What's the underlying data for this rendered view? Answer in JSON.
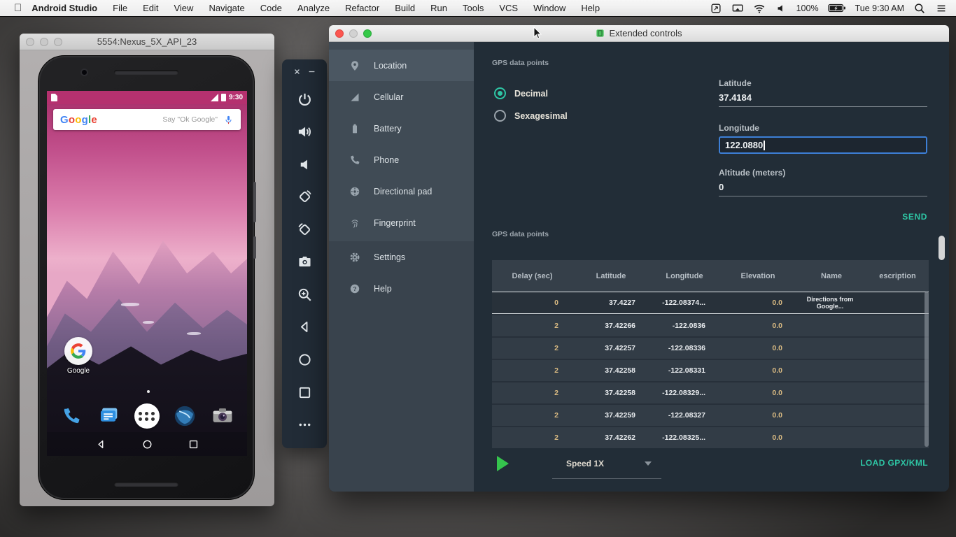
{
  "menu_bar": {
    "apple_logo": "apple-icon",
    "app_name": "Android Studio",
    "menus": [
      "File",
      "Edit",
      "View",
      "Navigate",
      "Code",
      "Analyze",
      "Refactor",
      "Build",
      "Run",
      "Tools",
      "VCS",
      "Window",
      "Help"
    ],
    "status": [
      {
        "icon": "sync-icon"
      },
      {
        "icon": "display-icon"
      },
      {
        "icon": "wifi-icon"
      },
      {
        "icon": "volume-menu-icon"
      },
      {
        "text": "100%"
      },
      {
        "icon": "mac-battery-icon"
      },
      {
        "text": "Tue 9:30 AM"
      },
      {
        "icon": "search-icon"
      },
      {
        "icon": "list-icon"
      }
    ]
  },
  "emulator": {
    "title": "5554:Nexus_5X_API_23",
    "phone": {
      "status_time": "9:30",
      "search": {
        "logo": "Google",
        "placeholder": "Say \"Ok Google\"",
        "mic_icon": "mic-icon"
      },
      "folder_label": "Google",
      "dock": [
        "phone-app-icon",
        "messenger-icon",
        "app-drawer-icon",
        "browser-icon",
        "camera-app-icon"
      ],
      "nav": [
        "back-nav-icon",
        "home-nav-icon",
        "overview-nav-icon"
      ]
    }
  },
  "toolbar": {
    "window_controls": [
      {
        "icon": "close-icon",
        "name": "toolbar-close-button"
      },
      {
        "icon": "minimize-icon",
        "name": "toolbar-minimize-button"
      }
    ],
    "buttons": [
      {
        "icon": "power-icon",
        "name": "power-button"
      },
      {
        "icon": "volume-up-icon",
        "name": "volume-up-button"
      },
      {
        "icon": "volume-down-icon",
        "name": "volume-down-button"
      },
      {
        "icon": "rotate-left-icon",
        "name": "rotate-left-button"
      },
      {
        "icon": "rotate-right-icon",
        "name": "rotate-right-button"
      },
      {
        "icon": "screenshot-icon",
        "name": "screenshot-button"
      },
      {
        "icon": "zoom-icon",
        "name": "zoom-button"
      },
      {
        "icon": "back-nav-icon",
        "name": "back-button"
      },
      {
        "icon": "home-nav-icon",
        "name": "home-button"
      },
      {
        "icon": "overview-nav-icon",
        "name": "overview-button"
      },
      {
        "icon": "more-icon",
        "name": "more-button"
      }
    ]
  },
  "extended": {
    "title": "Extended controls",
    "sidebar": [
      {
        "label": "Location",
        "icon": "location-pin-icon",
        "selected": true
      },
      {
        "label": "Cellular",
        "icon": "cellular-icon",
        "selected": false
      },
      {
        "label": "Battery",
        "icon": "battery-side-icon",
        "selected": false
      },
      {
        "label": "Phone",
        "icon": "phone-handset-icon",
        "selected": false
      },
      {
        "label": "Directional pad",
        "icon": "dpad-icon",
        "selected": false
      },
      {
        "label": "Fingerprint",
        "icon": "fingerprint-icon",
        "selected": false
      },
      {
        "label": "Settings",
        "icon": "gear-icon",
        "selected": false
      },
      {
        "label": "Help",
        "icon": "help-icon",
        "selected": false
      }
    ],
    "gps_form": {
      "section": "GPS data points",
      "radios": [
        {
          "label": "Decimal",
          "selected": true
        },
        {
          "label": "Sexagesimal",
          "selected": false
        }
      ],
      "fields": [
        {
          "label": "Latitude",
          "value": "37.4184",
          "focused": false
        },
        {
          "label": "Longitude",
          "value": "122.0880",
          "focused": true
        },
        {
          "label": "Altitude (meters)",
          "value": "0",
          "focused": false
        }
      ],
      "send_label": "SEND"
    },
    "table": {
      "section": "GPS data points",
      "columns": [
        "Delay (sec)",
        "Latitude",
        "Longitude",
        "Elevation",
        "Name",
        "escription"
      ],
      "selected_index": 0,
      "rows": [
        [
          "0",
          "37.4227",
          "-122.08374...",
          "0.0",
          "Directions from Google...",
          ""
        ],
        [
          "2",
          "37.42266",
          "-122.0836",
          "0.0",
          "",
          ""
        ],
        [
          "2",
          "37.42257",
          "-122.08336",
          "0.0",
          "",
          ""
        ],
        [
          "2",
          "37.42258",
          "-122.08331",
          "0.0",
          "",
          ""
        ],
        [
          "2",
          "37.42258",
          "-122.08329...",
          "0.0",
          "",
          ""
        ],
        [
          "2",
          "37.42259",
          "-122.08327",
          "0.0",
          "",
          ""
        ],
        [
          "2",
          "37.42262",
          "-122.08325...",
          "0.0",
          "",
          ""
        ]
      ]
    },
    "playback": {
      "play_icon": "play-icon",
      "speed_label": "Speed 1X",
      "load_label": "LOAD GPX/KML"
    }
  },
  "colors": {
    "accent_teal": "#2ec5a4",
    "focus_blue": "#3d7fd6",
    "play_green": "#35c44d",
    "status_magenta": "#b5316f"
  }
}
